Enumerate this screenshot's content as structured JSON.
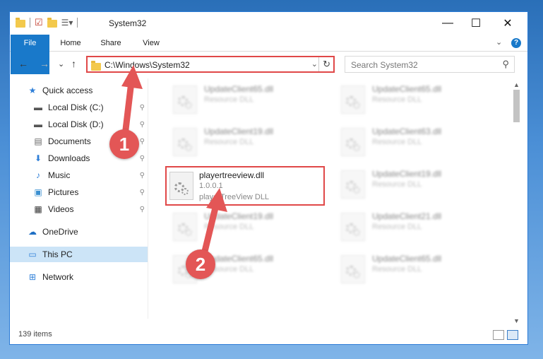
{
  "window": {
    "title": "System32",
    "controls": {
      "minimize": "—",
      "maximize": "☐",
      "close": "✕"
    }
  },
  "ribbon": {
    "tabs": [
      "File",
      "Home",
      "Share",
      "View"
    ],
    "collapse": "⌄",
    "help": "?"
  },
  "nav": {
    "back": "←",
    "forward": "→",
    "recent": "⌄",
    "up": "↑",
    "address": "C:\\Windows\\System32",
    "address_dropdown": "⌄",
    "refresh": "↻",
    "search_placeholder": "Search System32",
    "search_icon": "⚲"
  },
  "sidebar": {
    "items": [
      {
        "label": "Quick access",
        "icon": "star-icon",
        "glyph": "★",
        "pinned": false
      },
      {
        "label": "Local Disk (C:)",
        "icon": "drive-icon",
        "glyph": "▬",
        "pinned": true
      },
      {
        "label": "Local Disk (D:)",
        "icon": "drive-icon",
        "glyph": "▬",
        "pinned": true
      },
      {
        "label": "Documents",
        "icon": "documents-icon",
        "glyph": "▤",
        "pinned": true
      },
      {
        "label": "Downloads",
        "icon": "download-icon",
        "glyph": "⬇",
        "pinned": true
      },
      {
        "label": "Music",
        "icon": "music-icon",
        "glyph": "♪",
        "pinned": true
      },
      {
        "label": "Pictures",
        "icon": "pictures-icon",
        "glyph": "▣",
        "pinned": true
      },
      {
        "label": "Videos",
        "icon": "videos-icon",
        "glyph": "▦",
        "pinned": true
      },
      {
        "label": "OneDrive",
        "icon": "cloud-icon",
        "glyph": "☁",
        "pinned": false
      },
      {
        "label": "This PC",
        "icon": "computer-icon",
        "glyph": "▭",
        "pinned": false,
        "selected": true
      },
      {
        "label": "Network",
        "icon": "network-icon",
        "glyph": "⊞",
        "pinned": false
      }
    ],
    "pin_glyph": "📌"
  },
  "files": [
    {
      "name": "UpdateClient65.dll",
      "line1": "Resource DLL",
      "line2": "",
      "blur": true
    },
    {
      "name": "UpdateClient65.dll",
      "line1": "Resource DLL",
      "line2": "",
      "blur": true
    },
    {
      "name": "UpdateClient19.dll",
      "line1": "Resource DLL",
      "line2": "",
      "blur": true
    },
    {
      "name": "UpdateClient63.dll",
      "line1": "Resource DLL",
      "line2": "",
      "blur": true
    },
    {
      "name": "playertreeview.dll",
      "line1": "1.0.0.1",
      "line2": "playerTreeView DLL",
      "blur": false
    },
    {
      "name": "UpdateClient19.dll",
      "line1": "Resource DLL",
      "line2": "",
      "blur": true
    },
    {
      "name": "UpdateClient19.dll",
      "line1": "Resource DLL",
      "line2": "",
      "blur": true
    },
    {
      "name": "UpdateClient21.dll",
      "line1": "Resource DLL",
      "line2": "",
      "blur": true
    },
    {
      "name": "UpdateClient65.dll",
      "line1": "Resource DLL",
      "line2": "",
      "blur": true
    },
    {
      "name": "UpdateClient65.dll",
      "line1": "Resource DLL",
      "line2": "",
      "blur": true
    }
  ],
  "status": {
    "count": "139 items"
  },
  "annotations": {
    "step1": "1",
    "step2": "2",
    "color": "#e35656"
  }
}
